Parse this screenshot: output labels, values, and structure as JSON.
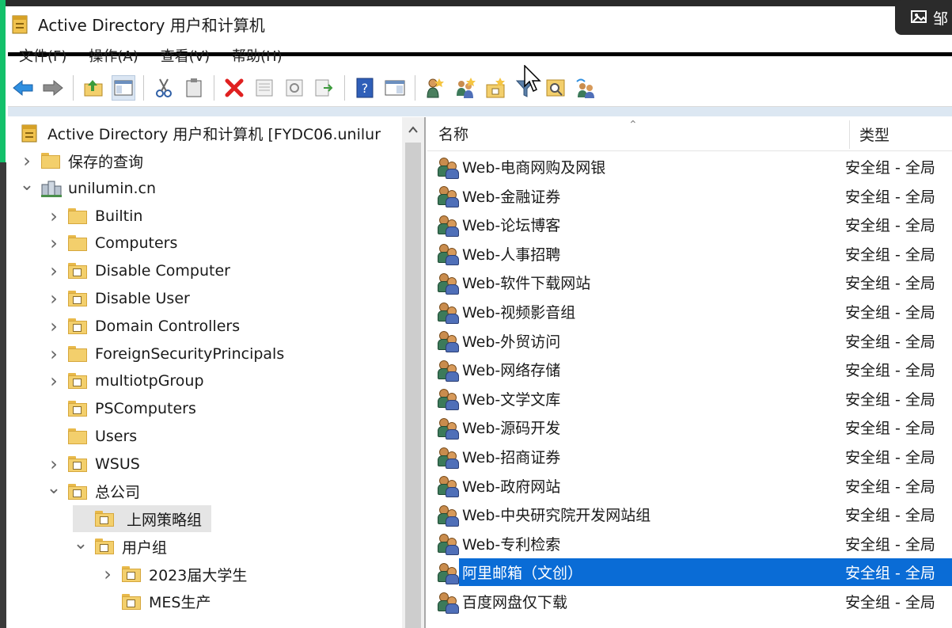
{
  "window": {
    "title": "Active Directory 用户和计算机",
    "overlay_text": "邹"
  },
  "menu": [
    "文件(F)",
    "操作(A)",
    "查看(V)",
    "帮助(H)"
  ],
  "toolbar": [
    "back-arrow-icon",
    "forward-arrow-icon",
    "up-folder-icon",
    "show-console-tree-icon",
    "cut-icon",
    "paste-icon",
    "delete-icon",
    "properties-icon",
    "refresh-icon",
    "export-list-icon",
    "help-icon",
    "show-action-pane-icon",
    "new-user-icon",
    "new-group-icon",
    "new-ou-icon",
    "filter-icon",
    "find-icon",
    "add-to-group-icon"
  ],
  "tree": {
    "root": "Active Directory 用户和计算机 [FYDC06.unilur",
    "items": [
      {
        "label": "保存的查询",
        "level": 1,
        "caret": "collapsed",
        "icon": "folder"
      },
      {
        "label": "unilumin.cn",
        "level": 1,
        "caret": "expanded",
        "icon": "domain"
      },
      {
        "label": "Builtin",
        "level": 2,
        "caret": "collapsed",
        "icon": "folder"
      },
      {
        "label": "Computers",
        "level": 2,
        "caret": "collapsed",
        "icon": "folder"
      },
      {
        "label": "Disable Computer",
        "level": 2,
        "caret": "collapsed",
        "icon": "ou"
      },
      {
        "label": "Disable User",
        "level": 2,
        "caret": "collapsed",
        "icon": "ou"
      },
      {
        "label": "Domain Controllers",
        "level": 2,
        "caret": "collapsed",
        "icon": "ou"
      },
      {
        "label": "ForeignSecurityPrincipals",
        "level": 2,
        "caret": "collapsed",
        "icon": "folder"
      },
      {
        "label": "multiotpGroup",
        "level": 2,
        "caret": "collapsed",
        "icon": "ou"
      },
      {
        "label": "PSComputers",
        "level": 2,
        "caret": "none",
        "icon": "ou"
      },
      {
        "label": "Users",
        "level": 2,
        "caret": "none",
        "icon": "folder"
      },
      {
        "label": "WSUS",
        "level": 2,
        "caret": "collapsed",
        "icon": "ou"
      },
      {
        "label": "总公司",
        "level": 2,
        "caret": "expanded",
        "icon": "ou"
      },
      {
        "label": "上网策略组",
        "level": 3,
        "caret": "none",
        "icon": "ou",
        "selected": true
      },
      {
        "label": "用户组",
        "level": 3,
        "caret": "expanded",
        "icon": "ou"
      },
      {
        "label": "2023届大学生",
        "level": 4,
        "caret": "collapsed",
        "icon": "ou"
      },
      {
        "label": "MES生产",
        "level": 4,
        "caret": "none",
        "icon": "ou"
      }
    ]
  },
  "list": {
    "columns": {
      "name": "名称",
      "type": "类型"
    },
    "rows": [
      {
        "name": "Web-电商网购及网银",
        "type": "安全组 - 全局"
      },
      {
        "name": "Web-金融证券",
        "type": "安全组 - 全局"
      },
      {
        "name": "Web-论坛博客",
        "type": "安全组 - 全局"
      },
      {
        "name": "Web-人事招聘",
        "type": "安全组 - 全局"
      },
      {
        "name": "Web-软件下载网站",
        "type": "安全组 - 全局"
      },
      {
        "name": "Web-视频影音组",
        "type": "安全组 - 全局"
      },
      {
        "name": "Web-外贸访问",
        "type": "安全组 - 全局"
      },
      {
        "name": "Web-网络存储",
        "type": "安全组 - 全局"
      },
      {
        "name": "Web-文学文库",
        "type": "安全组 - 全局"
      },
      {
        "name": "Web-源码开发",
        "type": "安全组 - 全局"
      },
      {
        "name": "Web-招商证券",
        "type": "安全组 - 全局"
      },
      {
        "name": "Web-政府网站",
        "type": "安全组 - 全局"
      },
      {
        "name": "Web-中央研究院开发网站组",
        "type": "安全组 - 全局"
      },
      {
        "name": "Web-专利检索",
        "type": "安全组 - 全局"
      },
      {
        "name": "阿里邮箱（文创）",
        "type": "安全组 - 全局",
        "selected": true
      },
      {
        "name": "百度网盘仅下载",
        "type": "安全组 - 全局"
      }
    ]
  },
  "colors": {
    "selection": "#0a6cd6",
    "accent_green": "#13c06a",
    "folder": "#f3cf6c"
  }
}
